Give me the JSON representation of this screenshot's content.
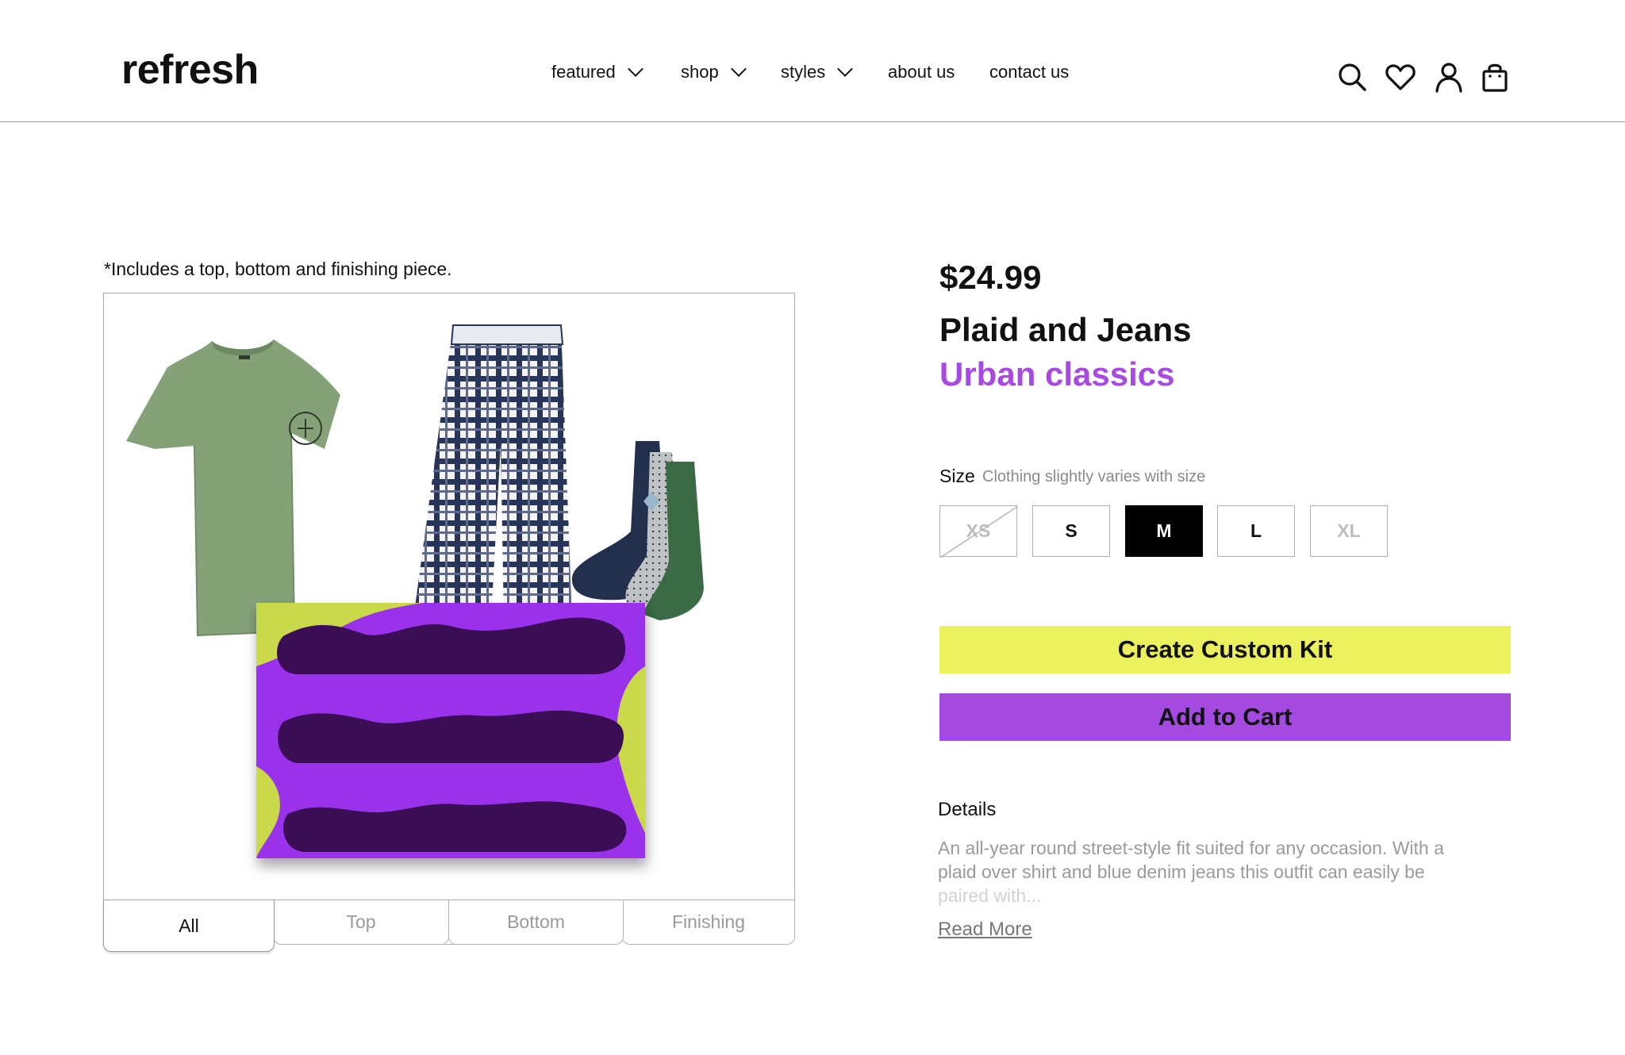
{
  "header": {
    "logo": "refresh",
    "nav": [
      {
        "label": "featured",
        "dropdown": true
      },
      {
        "label": "shop",
        "dropdown": true
      },
      {
        "label": "styles",
        "dropdown": true
      },
      {
        "label": "about us",
        "dropdown": false
      },
      {
        "label": "contact us",
        "dropdown": false
      }
    ],
    "icons": [
      "search-icon",
      "heart-icon",
      "user-icon",
      "shopping-bag-icon"
    ]
  },
  "gallery": {
    "note": "*Includes a top, bottom and finishing piece.",
    "images": [
      "green-tshirt",
      "plaid-pants",
      "socks",
      "purple-gift-box"
    ],
    "tabs": [
      "All",
      "Top",
      "Bottom",
      "Finishing"
    ],
    "active_tab": "All"
  },
  "product": {
    "price": "$24.99",
    "title": "Plaid and Jeans",
    "subtitle": "Urban classics",
    "size_label": "Size",
    "size_hint": "Clothing slightly varies with size",
    "sizes": [
      {
        "label": "XS",
        "state": "unavailable"
      },
      {
        "label": "S",
        "state": "available"
      },
      {
        "label": "M",
        "state": "selected"
      },
      {
        "label": "L",
        "state": "available"
      },
      {
        "label": "XL",
        "state": "disabled"
      }
    ],
    "create_kit_label": "Create Custom Kit",
    "add_to_cart_label": "Add to Cart",
    "details_heading": "Details",
    "details_text": "An all-year round street-style fit suited for any occasion. With a plaid over shirt and blue denim jeans this outfit can easily be",
    "details_fade": "paired with...",
    "read_more": "Read More"
  },
  "colors": {
    "accent_purple": "#a64ae0",
    "accent_yellow": "#ecf05c",
    "button_purple": "#a54ae0",
    "selected_size": "#000000"
  }
}
